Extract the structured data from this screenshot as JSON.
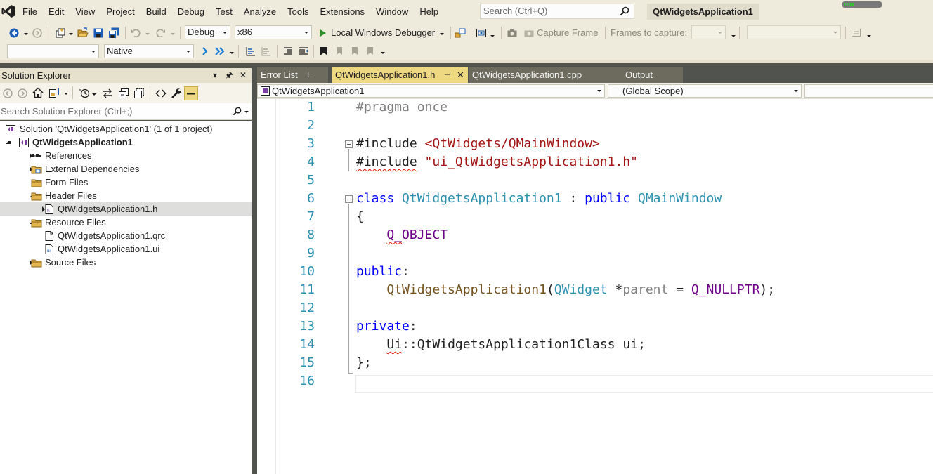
{
  "window": {
    "title": "QtWidgetsApplication1"
  },
  "menu": [
    "File",
    "Edit",
    "View",
    "Project",
    "Build",
    "Debug",
    "Test",
    "Analyze",
    "Tools",
    "Extensions",
    "Window",
    "Help"
  ],
  "search": {
    "placeholder": "Search (Ctrl+Q)"
  },
  "toolbar1": {
    "config": "Debug",
    "platform": "x86",
    "debugger": "Local Windows Debugger",
    "capture_frame": "Capture Frame",
    "frames_to_capture": "Frames to capture:"
  },
  "toolbar2": {
    "target": "",
    "native": "Native"
  },
  "solution_explorer": {
    "title": "Solution Explorer",
    "search_placeholder": "Search Solution Explorer (Ctrl+;)",
    "tree": [
      {
        "label": "Solution 'QtWidgetsApplication1' (1 of 1 project)",
        "icon": "solution-icon",
        "level": 0,
        "expander": "none",
        "bold": false,
        "selected": false
      },
      {
        "label": "QtWidgetsApplication1",
        "icon": "qt-project-icon",
        "level": 0,
        "expander": "expanded",
        "bold": true,
        "selected": false
      },
      {
        "label": "References",
        "icon": "references-icon",
        "level": 1,
        "expander": "collapsed",
        "bold": false,
        "selected": false
      },
      {
        "label": "External Dependencies",
        "icon": "external-dependencies-icon",
        "level": 1,
        "expander": "collapsed",
        "bold": false,
        "selected": false
      },
      {
        "label": "Form Files",
        "icon": "filter-folder-icon",
        "level": 1,
        "expander": "none",
        "bold": false,
        "selected": false
      },
      {
        "label": "Header Files",
        "icon": "filter-folder-icon",
        "level": 1,
        "expander": "expanded",
        "bold": false,
        "selected": false
      },
      {
        "label": "QtWidgetsApplication1.h",
        "icon": "header-file-icon",
        "level": 2,
        "expander": "collapsed",
        "bold": false,
        "selected": true
      },
      {
        "label": "Resource Files",
        "icon": "filter-folder-icon",
        "level": 1,
        "expander": "expanded",
        "bold": false,
        "selected": false
      },
      {
        "label": "QtWidgetsApplication1.qrc",
        "icon": "file-icon",
        "level": 2,
        "expander": "none",
        "bold": false,
        "selected": false
      },
      {
        "label": "QtWidgetsApplication1.ui",
        "icon": "ui-file-icon",
        "level": 2,
        "expander": "none",
        "bold": false,
        "selected": false
      },
      {
        "label": "Source Files",
        "icon": "filter-folder-icon",
        "level": 1,
        "expander": "collapsed",
        "bold": false,
        "selected": false
      }
    ]
  },
  "tabs": [
    {
      "label": "Error List",
      "state": "inactive",
      "pinned": true
    },
    {
      "label": "QtWidgetsApplication1.h",
      "state": "active",
      "pinned": true,
      "closable": true
    },
    {
      "label": "QtWidgetsApplication1.cpp",
      "state": "inactive"
    },
    {
      "label": "Output",
      "state": "inactive"
    }
  ],
  "navigation": {
    "project_scope": "QtWidgetsApplication1",
    "global_scope": "(Global Scope)"
  },
  "editor": {
    "current_line": 16,
    "lines": [
      {
        "n": "1",
        "tokens": [
          [
            "pp",
            "#pragma once"
          ]
        ]
      },
      {
        "n": "2",
        "tokens": []
      },
      {
        "n": "3",
        "tokens": [
          [
            "def",
            "#include "
          ],
          [
            "str",
            "<QtWidgets/QMainWindow>"
          ]
        ]
      },
      {
        "n": "4",
        "tokens": [
          [
            "def-sq",
            "#include"
          ],
          [
            "def",
            " "
          ],
          [
            "str",
            "\"ui_QtWidgetsApplication1.h\""
          ]
        ]
      },
      {
        "n": "5",
        "tokens": []
      },
      {
        "n": "6",
        "tokens": [
          [
            "kw",
            "class"
          ],
          [
            "def",
            " "
          ],
          [
            "type",
            "QtWidgetsApplication1"
          ],
          [
            "def",
            " : "
          ],
          [
            "kw",
            "public"
          ],
          [
            "def",
            " "
          ],
          [
            "type",
            "QMainWindow"
          ]
        ]
      },
      {
        "n": "7",
        "tokens": [
          [
            "def",
            "{"
          ]
        ]
      },
      {
        "n": "8",
        "tokens": [
          [
            "def",
            "    "
          ],
          [
            "macro-sq",
            "Q_"
          ],
          [
            "macro",
            "OBJECT"
          ]
        ]
      },
      {
        "n": "9",
        "tokens": []
      },
      {
        "n": "10",
        "tokens": [
          [
            "kw",
            "public"
          ],
          [
            "def",
            ":"
          ]
        ]
      },
      {
        "n": "11",
        "tokens": [
          [
            "def",
            "    "
          ],
          [
            "fn",
            "QtWidgetsApplication1"
          ],
          [
            "def",
            "("
          ],
          [
            "type",
            "QWidget"
          ],
          [
            "def",
            " *"
          ],
          [
            "param",
            "parent"
          ],
          [
            "def",
            " = "
          ],
          [
            "macro",
            "Q_NULLPTR"
          ],
          [
            "def",
            ");"
          ]
        ]
      },
      {
        "n": "12",
        "tokens": []
      },
      {
        "n": "13",
        "tokens": [
          [
            "kw",
            "private"
          ],
          [
            "def",
            ":"
          ]
        ]
      },
      {
        "n": "14",
        "tokens": [
          [
            "def",
            "    "
          ],
          [
            "def-sq",
            "Ui"
          ],
          [
            "def",
            "::QtWidgetsApplication1Class ui;"
          ]
        ]
      },
      {
        "n": "15",
        "tokens": [
          [
            "def",
            "};"
          ]
        ]
      },
      {
        "n": "16",
        "tokens": []
      }
    ]
  }
}
